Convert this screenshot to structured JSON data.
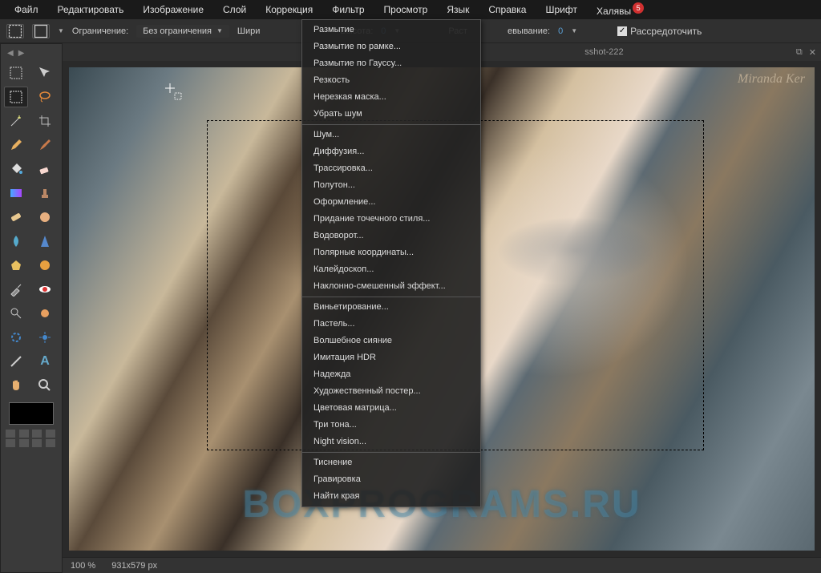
{
  "menubar": {
    "items": [
      "Файл",
      "Редактировать",
      "Изображение",
      "Слой",
      "Коррекция",
      "Фильтр",
      "Просмотр",
      "Язык",
      "Справка",
      "Шрифт",
      "Халявы"
    ],
    "badge": "5"
  },
  "optionsbar": {
    "constraint_label": "Ограничение:",
    "constraint_value": "Без ограничения",
    "width_label": "Шири",
    "height_label": "Высота:",
    "height_value": "0",
    "feather_label": "евывание:",
    "feather_prefix": "Раст",
    "feather_value": "0",
    "defocus_label": "Рассредоточить"
  },
  "tab": {
    "title": "sshot-222"
  },
  "dropdown": {
    "groups": [
      [
        "Размытие",
        "Размытие по рамке...",
        "Размытие по Гауссу...",
        "Резкость",
        "Нерезкая маска...",
        "Убрать шум"
      ],
      [
        "Шум...",
        "Диффузия...",
        "Трассировка...",
        "Полутон...",
        "Оформление...",
        "Придание точечного стиля...",
        "Водоворот...",
        "Полярные координаты...",
        "Калейдоскоп...",
        "Наклонно-смешенный эффект..."
      ],
      [
        "Виньетирование...",
        "Пастель...",
        "Волшебное сияние",
        "Имитация HDR",
        "Надежда",
        "Художественный постер...",
        "Цветовая матрица...",
        "Три тона...",
        "Night vision..."
      ],
      [
        "Тиснение",
        "Гравировка",
        "Найти края"
      ]
    ]
  },
  "canvas": {
    "watermark": "Miranda Ker",
    "brand": "BOXPROGRAMS.RU"
  },
  "statusbar": {
    "zoom": "100 %",
    "dims": "931x579 px"
  },
  "tools": {
    "names": [
      "marquee-rect",
      "move",
      "marquee-select",
      "lasso",
      "wand",
      "crop",
      "pencil",
      "brush",
      "bucket",
      "eraser",
      "gradient",
      "stamp",
      "heal",
      "smudge",
      "blur",
      "sharpen",
      "sponge",
      "color-replace",
      "eyedropper",
      "redeye",
      "dodge",
      "burn",
      "pen",
      "text",
      "hand",
      "zoom"
    ]
  }
}
